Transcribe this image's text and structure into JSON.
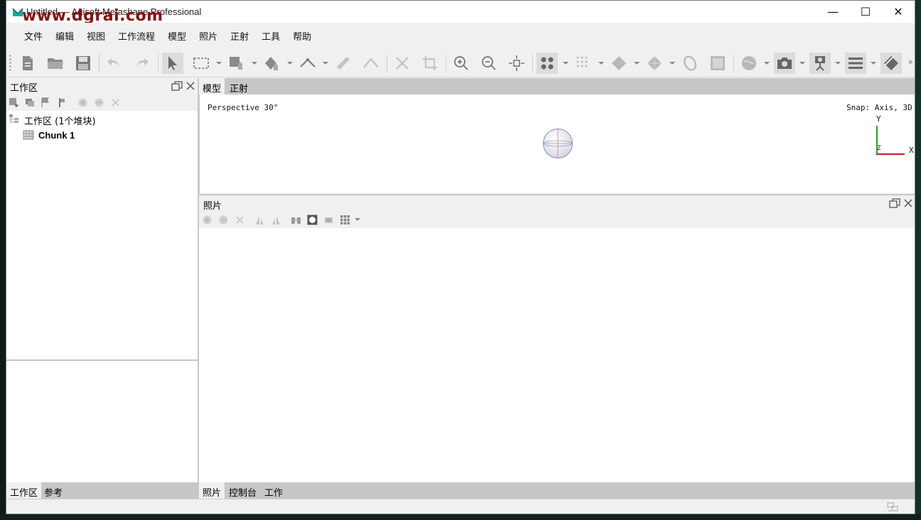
{
  "window": {
    "title": "Untitled — Agisoft Metashape Professional",
    "watermark": "www.dgrai.com",
    "controls": {
      "minimize": "—",
      "maximize": "☐",
      "close": "✕"
    }
  },
  "menu": [
    "文件",
    "编辑",
    "视图",
    "工作流程",
    "模型",
    "照片",
    "正射",
    "工具",
    "帮助"
  ],
  "toolbar": {
    "icons": [
      "new-document-icon",
      "open-folder-icon",
      "save-icon",
      "undo-icon",
      "redo-icon",
      "navigation-pointer-icon",
      "rectangle-selection-icon",
      "shape-hand-icon",
      "draw-polygon-icon",
      "ruler-point-icon",
      "ruler-icon",
      "draw-polyline-icon",
      "delete-icon",
      "crop-icon",
      "zoom-in-icon",
      "zoom-out-icon",
      "reset-view-icon",
      "point-cloud-icon",
      "dense-cloud-icon",
      "mesh-shaded-icon",
      "mesh-solid-icon",
      "tiled-model-icon",
      "texture-icon",
      "dem-icon",
      "camera-icon",
      "video-camera-icon",
      "menu-icon",
      "ortho-icon"
    ],
    "more": "»"
  },
  "workspace": {
    "title": "工作区",
    "root_label": "工作区 (1个堆块)",
    "chunk_label": "Chunk 1",
    "tabs": [
      "工作区",
      "参考"
    ]
  },
  "model": {
    "tabs": [
      "模型",
      "正射"
    ],
    "perspective": "Perspective 30°",
    "snap": "Snap: Axis, 3D",
    "axis_y": "Y",
    "axis_x": "X",
    "axis_z": "Z"
  },
  "photos": {
    "title": "照片",
    "tabs": [
      "照片",
      "控制台",
      "工作"
    ]
  },
  "colors": {
    "accent_teal": "#1aa8a0",
    "axis_y": "#2aa02a",
    "axis_x": "#b02020",
    "watermark": "#8a1010"
  }
}
